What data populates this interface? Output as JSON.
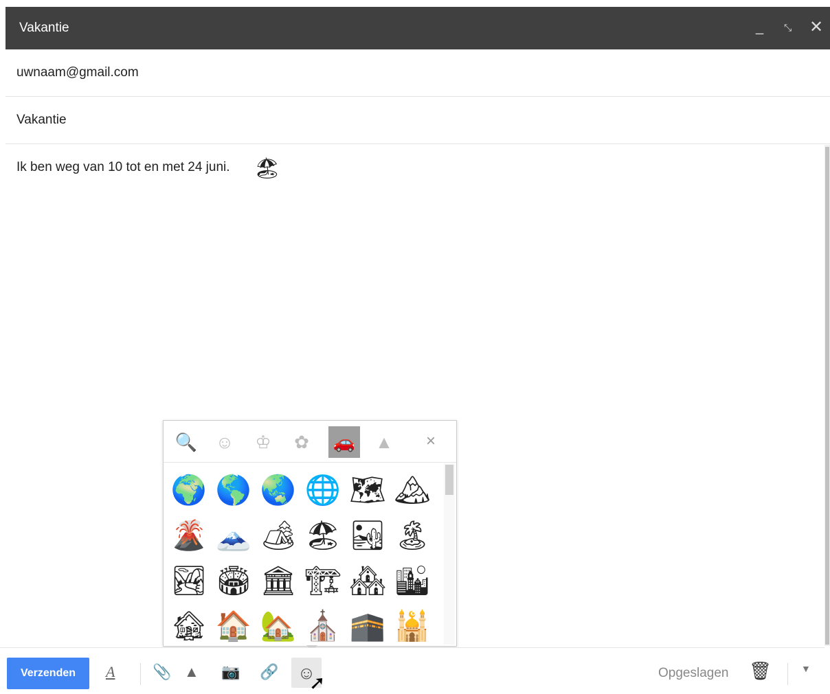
{
  "window": {
    "title": "Vakantie",
    "minimize_icon": "_",
    "expand_icon": "⤡",
    "close_icon": "✕"
  },
  "fields": {
    "to": "uwnaam@gmail.com",
    "subject": "Vakantie"
  },
  "body": {
    "text": "Ik ben weg van 10 tot en met 24 juni.",
    "emoji": "🏖"
  },
  "emoji_picker": {
    "tabs": [
      {
        "name": "search",
        "glyph": "🔍"
      },
      {
        "name": "smileys",
        "glyph": "☺"
      },
      {
        "name": "objects",
        "glyph": "♔"
      },
      {
        "name": "nature",
        "glyph": "✿"
      },
      {
        "name": "travel",
        "glyph": "🚗"
      },
      {
        "name": "symbols",
        "glyph": "▲"
      }
    ],
    "close_glyph": "×",
    "emojis": [
      "🌍",
      "🌎",
      "🌏",
      "🌐",
      "🗺",
      "🏔",
      "🌋",
      "🗻",
      "🏕",
      "🏖",
      "🏜",
      "🏝",
      "🏞",
      "🏟",
      "🏛",
      "🏗",
      "🏘",
      "🏙",
      "🏚",
      "🏠",
      "🏡",
      "⛪",
      "🕋",
      "🕌"
    ]
  },
  "toolbar": {
    "send_label": "Verzenden",
    "format_icon": "A",
    "attach_icon": "📎",
    "drive_icon": "▲",
    "photo_icon": "📷",
    "link_icon": "🔗",
    "emoji_icon": "☺",
    "saved_label": "Opgeslagen",
    "trash_icon": "🗑",
    "more_icon": "▼"
  }
}
